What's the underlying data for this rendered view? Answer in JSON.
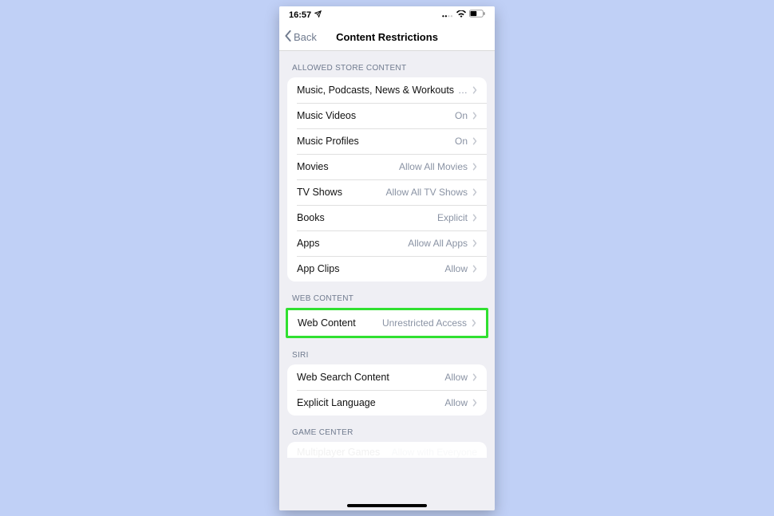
{
  "status": {
    "time": "16:57"
  },
  "nav": {
    "back": "Back",
    "title": "Content Restrictions"
  },
  "sections": {
    "allowed_header": "ALLOWED STORE CONTENT",
    "allowed": [
      {
        "label": "Music, Podcasts, News & Workouts",
        "value": "…"
      },
      {
        "label": "Music Videos",
        "value": "On"
      },
      {
        "label": "Music Profiles",
        "value": "On"
      },
      {
        "label": "Movies",
        "value": "Allow All Movies"
      },
      {
        "label": "TV Shows",
        "value": "Allow All TV Shows"
      },
      {
        "label": "Books",
        "value": "Explicit"
      },
      {
        "label": "Apps",
        "value": "Allow All Apps"
      },
      {
        "label": "App Clips",
        "value": "Allow"
      }
    ],
    "web_header": "WEB CONTENT",
    "web": {
      "label": "Web Content",
      "value": "Unrestricted Access"
    },
    "siri_header": "SIRI",
    "siri": [
      {
        "label": "Web Search Content",
        "value": "Allow"
      },
      {
        "label": "Explicit Language",
        "value": "Allow"
      }
    ],
    "gc_header": "GAME CENTER",
    "gc_cut": {
      "label": "Multiplayer Games",
      "value": "Allow with Everyone"
    }
  }
}
